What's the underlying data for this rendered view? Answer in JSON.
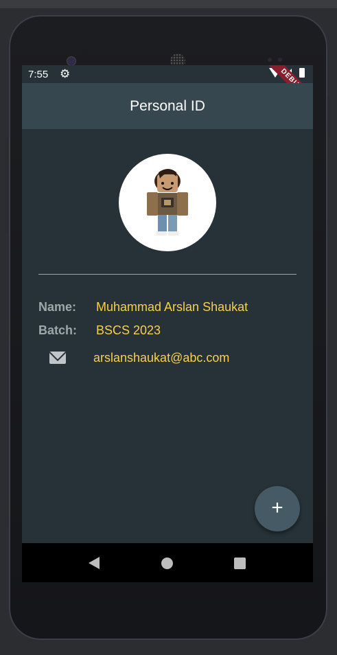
{
  "status_bar": {
    "time": "7:55",
    "gear_icon": "gear-icon",
    "wifi_icon": "wifi-icon",
    "signal_icon": "signal-icon",
    "battery_icon": "battery-icon"
  },
  "debug_banner": "DEBUG",
  "app_bar": {
    "title": "Personal ID"
  },
  "profile": {
    "name_label": "Name:",
    "name_value": "Muhammad Arslan Shaukat",
    "batch_label": "Batch:",
    "batch_value": "BSCS 2023",
    "email_icon": "mail-icon",
    "email_value": "arslanshaukat@abc.com"
  },
  "fab": {
    "icon": "plus-icon",
    "label": "+"
  },
  "nav_bar": {
    "back_icon": "back-icon",
    "home_icon": "home-icon",
    "recents_icon": "recents-icon"
  },
  "colors": {
    "background": "#263238",
    "app_bar": "#37474f",
    "accent_text": "#f8d04a",
    "label_text": "#9ea7ab",
    "fab": "#455a64"
  }
}
